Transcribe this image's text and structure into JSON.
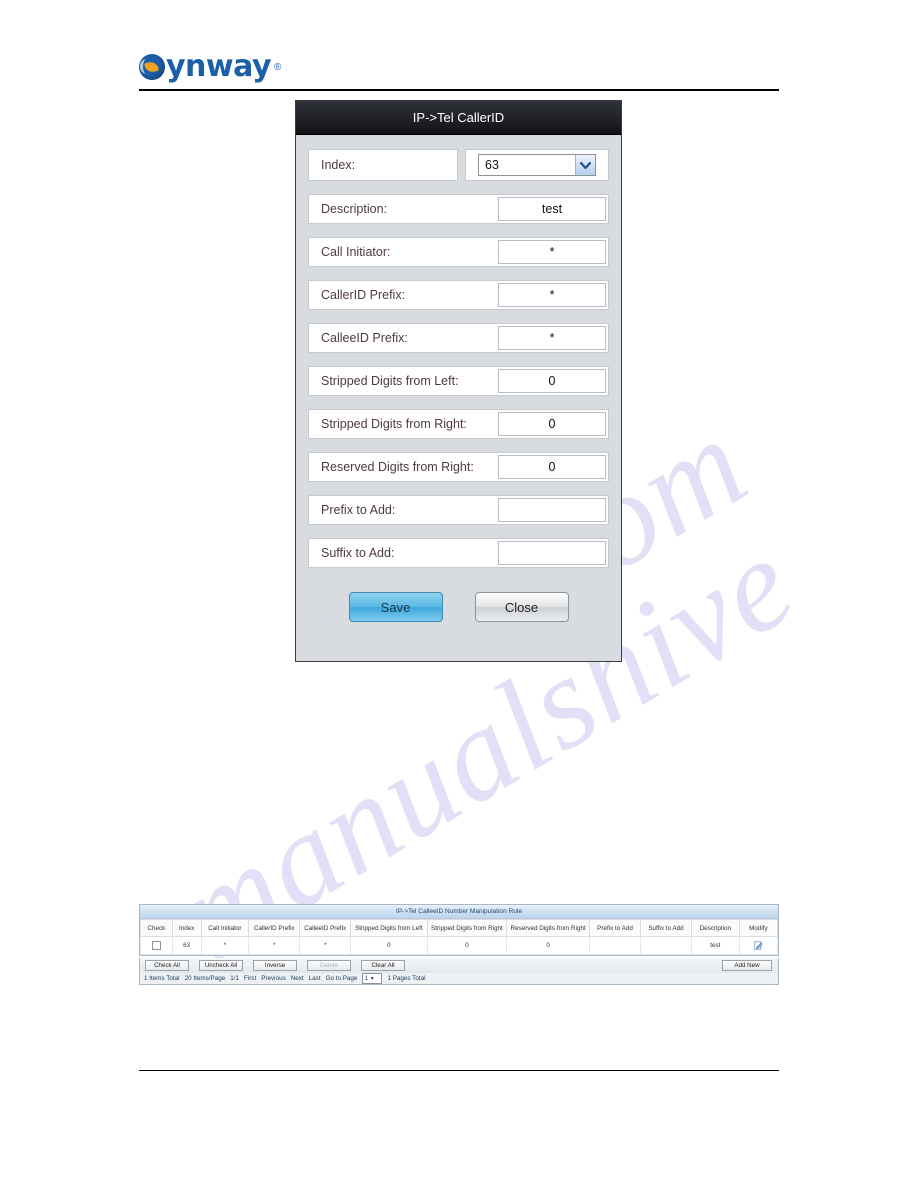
{
  "brand": {
    "name": "ynway",
    "registered": "®",
    "color": "#1a5fa8"
  },
  "watermark": {
    "line1": "manualshive",
    "line2": ".com"
  },
  "dialog": {
    "title": "IP->Tel CallerID",
    "index": {
      "label": "Index:",
      "value": "63"
    },
    "rows": [
      {
        "label": "Description:",
        "value": "test"
      },
      {
        "label": "Call Initiator:",
        "value": "*"
      },
      {
        "label": "CallerID Prefix:",
        "value": "*"
      },
      {
        "label": "CalleeID Prefix:",
        "value": "*"
      },
      {
        "label": "Stripped Digits from Left:",
        "value": "0"
      },
      {
        "label": "Stripped Digits from Right:",
        "value": "0"
      },
      {
        "label": "Reserved Digits from Right:",
        "value": "0"
      },
      {
        "label": "Prefix to Add:",
        "value": ""
      },
      {
        "label": "Suffix to Add:",
        "value": ""
      }
    ],
    "buttons": {
      "save": "Save",
      "close": "Close"
    }
  },
  "table": {
    "title": "IP->Tel CalleeID Number Manipulation Rule",
    "columns": [
      "Check",
      "Index",
      "Call Initiator",
      "CallerID Prefix",
      "CalleeID Prefix",
      "Stripped Digits from Left",
      "Stripped Digits from Right",
      "Reserved Digits from Right",
      "Prefix to Add",
      "Suffix to Add",
      "Description",
      "Modify"
    ],
    "rows": [
      {
        "check": "",
        "index": "63",
        "call_initiator": "*",
        "callerid_prefix": "*",
        "calleeid_prefix": "*",
        "stripped_left": "0",
        "stripped_right": "0",
        "reserved_right": "0",
        "prefix_to_add": "",
        "suffix_to_add": "",
        "description": "test",
        "modify": "edit-icon"
      }
    ],
    "toolbar": {
      "check_all": "Check All",
      "uncheck_all": "Uncheck All",
      "inverse": "Inverse",
      "delete": "Delete",
      "clear_all": "Clear All",
      "add_new": "Add New"
    },
    "pager": {
      "items_total": "1 Items Total",
      "items_per_page": "20 Items/Page",
      "page_of": "1/1",
      "first": "First",
      "previous": "Previous",
      "next": "Next",
      "last": "Last",
      "goto_label": "Go to Page",
      "goto_value": "1",
      "pages_total": "1 Pages Total"
    }
  }
}
